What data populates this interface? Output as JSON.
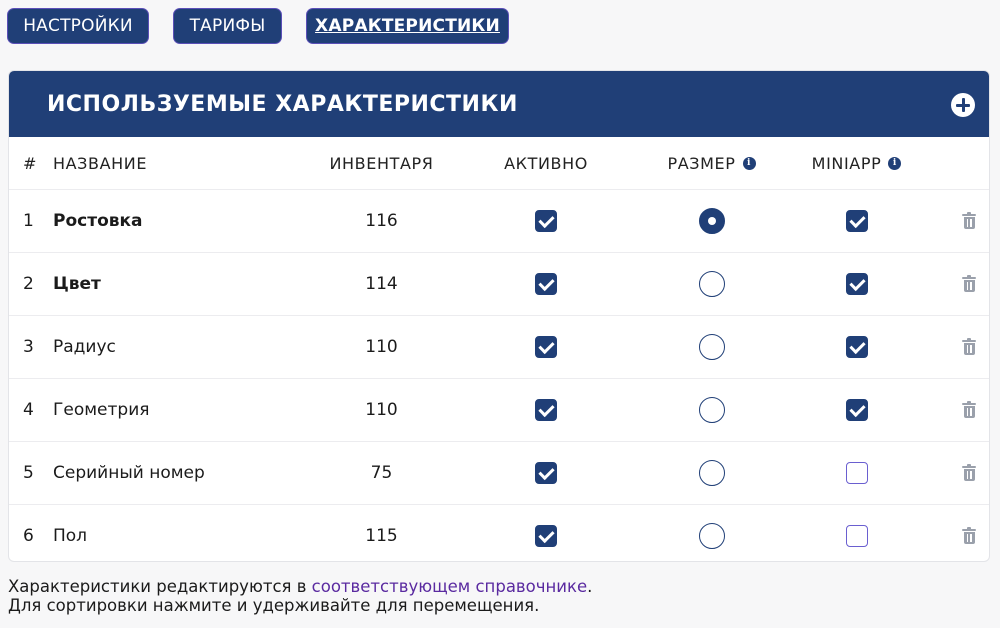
{
  "tabs": [
    {
      "label": "НАСТРОЙКИ",
      "active": false
    },
    {
      "label": "ТАРИФЫ",
      "active": false
    },
    {
      "label": "ХАРАКТЕРИСТИКИ",
      "active": true
    }
  ],
  "card": {
    "title": "ИСПОЛЬЗУЕМЫЕ ХАРАКТЕРИСТИКИ",
    "add_icon": "plus-circle-icon"
  },
  "columns": {
    "num": "#",
    "name": "НАЗВАНИЕ",
    "inventory": "ИНВЕНТАРЯ",
    "active": "АКТИВНО",
    "size": "РАЗМЕР",
    "miniapp": "MINIAPP"
  },
  "rows": [
    {
      "num": "1",
      "name": "Ростовка",
      "bold": true,
      "inventory": "116",
      "active": true,
      "size": true,
      "miniapp": true
    },
    {
      "num": "2",
      "name": "Цвет",
      "bold": true,
      "inventory": "114",
      "active": true,
      "size": false,
      "miniapp": true
    },
    {
      "num": "3",
      "name": "Радиус",
      "bold": false,
      "inventory": "110",
      "active": true,
      "size": false,
      "miniapp": true
    },
    {
      "num": "4",
      "name": "Геометрия",
      "bold": false,
      "inventory": "110",
      "active": true,
      "size": false,
      "miniapp": true
    },
    {
      "num": "5",
      "name": "Серийный номер",
      "bold": false,
      "inventory": "75",
      "active": true,
      "size": false,
      "miniapp": false
    },
    {
      "num": "6",
      "name": "Пол",
      "bold": false,
      "inventory": "115",
      "active": true,
      "size": false,
      "miniapp": false
    }
  ],
  "footer": {
    "line1_prefix": "Характеристики редактируются в ",
    "line1_link": "соответствующем справочнике",
    "line1_suffix": ".",
    "line2": "Для сортировки нажмите и удерживайте для перемещения."
  },
  "colors": {
    "primary": "#203f77",
    "link": "#5a2aa0",
    "checkbox_border": "#6a5fd0",
    "trash": "#9aa0ab"
  }
}
